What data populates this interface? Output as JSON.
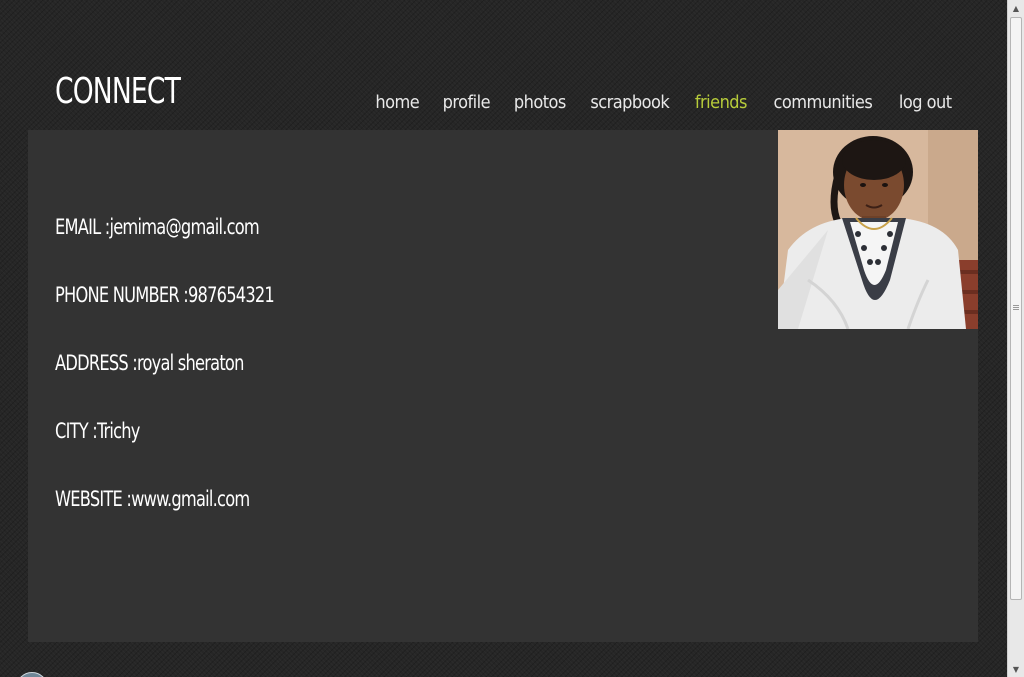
{
  "site": {
    "logo": "CONNECT"
  },
  "nav": {
    "items": [
      {
        "label": "home",
        "active": false
      },
      {
        "label": "profile",
        "active": false
      },
      {
        "label": "photos",
        "active": false
      },
      {
        "label": "scrapbook",
        "active": false
      },
      {
        "label": "friends",
        "active": true
      },
      {
        "label": "communities",
        "active": false
      },
      {
        "label": "log out",
        "active": false
      }
    ]
  },
  "profile": {
    "email": "EMAIL :jemima@gmail.com",
    "phone": "PHONE NUMBER :987654321",
    "address": "ADDRESS :royal sheraton",
    "city": "CITY :Trichy",
    "website": "WEBSITE :www.gmail.com"
  },
  "colors": {
    "background": "#262626",
    "panel": "#333333",
    "text": "#ffffff",
    "nav_text": "#e8e8e8",
    "nav_active": "#b7cc3a"
  },
  "icons": {
    "profile_photo": "person-photo"
  }
}
